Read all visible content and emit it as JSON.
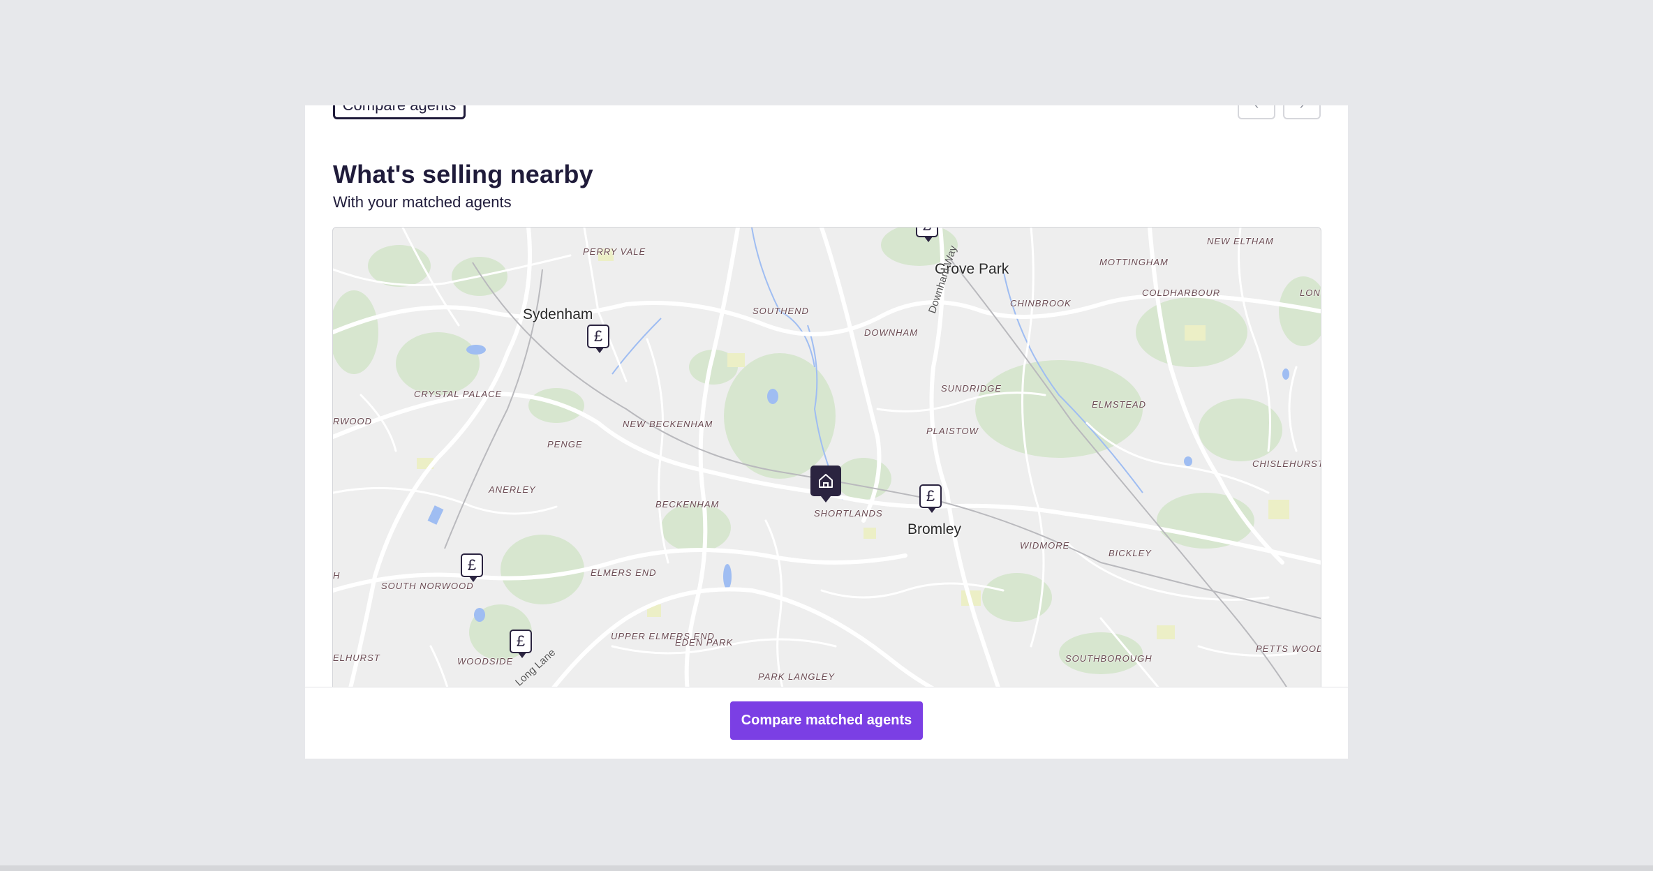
{
  "header": {
    "compare_agents_label": "Compare agents",
    "prev_label": "‹",
    "next_label": "›"
  },
  "section": {
    "title": "What's selling nearby",
    "subtitle": "With your matched agents"
  },
  "map": {
    "towns": [
      "Grove Park",
      "Sydenham",
      "Bromley"
    ],
    "areas": [
      "PERRY VALE",
      "SOUTHEND",
      "DOWNHAM",
      "MOTTINGHAM",
      "NEW ELTHAM",
      "COLDHARBOUR",
      "CHINBROOK",
      "CRYSTAL PALACE",
      "NEW BECKENHAM",
      "SUNDRIDGE",
      "PLAISTOW",
      "ELMSTEAD",
      "CHISLEHURST",
      "PENGE",
      "ANERLEY",
      "BECKENHAM",
      "SHORTLANDS",
      "WIDMORE",
      "BICKLEY",
      "SOUTH NORWOOD",
      "ELMERS END",
      "UPPER ELMERS END",
      "EDEN PARK",
      "WOODSIDE",
      "PARK LANGLEY",
      "SOUTHBOROUGH",
      "PETTS WOOD",
      "RWOOD",
      "ELHURST",
      "H",
      "LONG"
    ],
    "roads": [
      "Downham Way",
      "Long Lane"
    ],
    "sale_pin_symbol": "£",
    "home_icon": "home-icon"
  },
  "footer": {
    "cta_label": "Compare matched agents"
  },
  "colors": {
    "brand_dark": "#1f1b3a",
    "cta": "#7b3fe4"
  }
}
